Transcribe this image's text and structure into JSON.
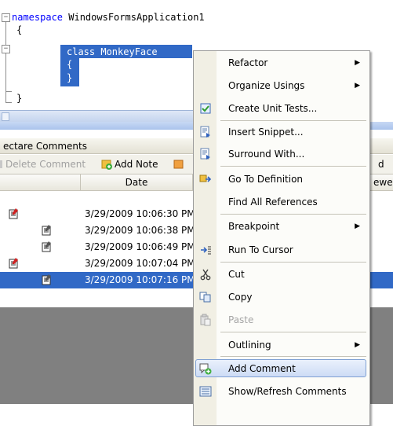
{
  "editor": {
    "line1_keyword": "namespace",
    "line1_name": " WindowsFormsApplication1",
    "line2": "{",
    "line3_keyword": "class",
    "line3_name": " MonkeyFace",
    "line4": "{",
    "line5": "}",
    "line6": "}",
    "fold_minus": "−"
  },
  "panel": {
    "title": "ectare Comments",
    "toolbar": {
      "delete_label": "Delete Comment",
      "add_note_label": "Add Note",
      "cut_right": "d"
    },
    "columns": {
      "date": "Date",
      "viewer_partial": "ewer"
    },
    "rows": [
      {
        "date": "3/29/2009 10:06:30 PM"
      },
      {
        "date": "3/29/2009 10:06:38 PM"
      },
      {
        "date": "3/29/2009 10:06:49 PM"
      },
      {
        "date": "3/29/2009 10:07:04 PM"
      },
      {
        "date": "3/29/2009 10:07:16 PM"
      }
    ]
  },
  "context_menu": {
    "refactor": "Refactor",
    "organize_usings": "Organize Usings",
    "create_unit_tests": "Create Unit Tests...",
    "insert_snippet": "Insert Snippet...",
    "surround_with": "Surround With...",
    "go_to_definition": "Go To Definition",
    "find_all_references": "Find All References",
    "breakpoint": "Breakpoint",
    "run_to_cursor": "Run To Cursor",
    "cut": "Cut",
    "copy": "Copy",
    "paste": "Paste",
    "outlining": "Outlining",
    "add_comment": "Add Comment",
    "show_refresh_comments": "Show/Refresh Comments",
    "submenu_arrow": "▶"
  },
  "colors": {
    "selection": "#3169c6",
    "keyword": "#0000ff",
    "menu_hover_border": "#7fa0d3"
  }
}
